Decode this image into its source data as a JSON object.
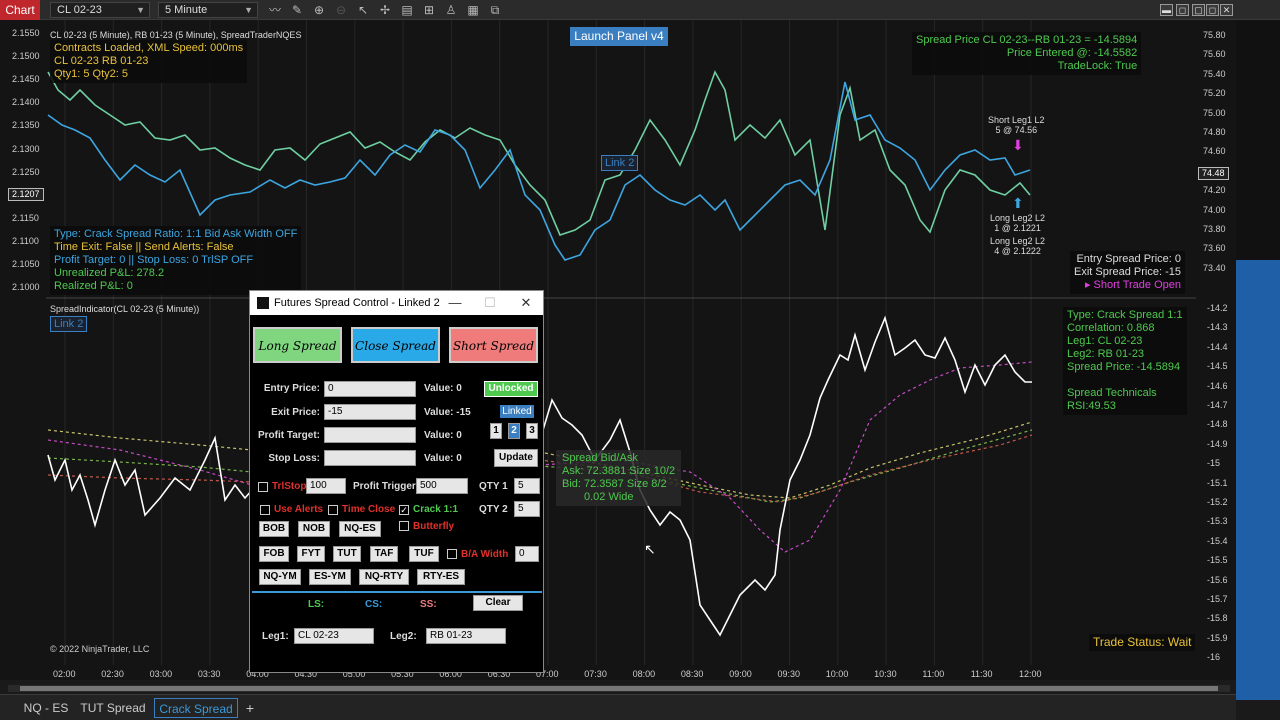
{
  "topbar": {
    "chart_tab": "Chart",
    "instrument": "CL 02-23",
    "interval": "5 Minute"
  },
  "top_panel": {
    "header": "CL 02-23 (5 Minute), RB 01-23 (5 Minute), SpreadTraderNQES",
    "info_lines": [
      "Contracts Loaded,  XML Speed: 000ms",
      "CL 02-23  RB 01-23",
      "Qty1: 5  Qty2: 5"
    ],
    "launch_button": "Launch Panel v4",
    "link_label": "Link 2",
    "spread_price_line": "Spread Price CL 02-23--RB 01-23 = -14.5894",
    "price_entered_line": "Price Entered @: -14.5582",
    "tradelock_line": "TradeLock: True",
    "short_leg_label": [
      "Short Leg1 L2",
      "5 @ 74.56"
    ],
    "long_leg_label_1": [
      "Long Leg2 L2",
      "1 @ 2.1221"
    ],
    "long_leg_label_2": [
      "Long Leg2 L2",
      "4 @ 2.1222"
    ],
    "status_lines": [
      "Type: Crack Spread Ratio: 1:1  Bid Ask Width OFF",
      "Time Exit: False  ||  Send Alerts: False",
      "Profit Target: 0  ||  Stop Loss: 0  TrlSP OFF",
      "Unrealized P&L: 278.2",
      "Realized P&L: 0"
    ],
    "entry_spread": "Entry Spread Price: 0",
    "exit_spread": "Exit Spread Price: -15",
    "short_trade_open": "▸ Short Trade Open",
    "left_axis": [
      "2.1550",
      "2.1500",
      "2.1450",
      "2.1400",
      "2.1350",
      "2.1300",
      "2.1250",
      "2.1200",
      "2.1150",
      "2.1100",
      "2.1050",
      "2.1000"
    ],
    "left_current": "2.1207",
    "right_axis": [
      "75.80",
      "75.60",
      "75.40",
      "75.20",
      "75.00",
      "74.80",
      "74.60",
      "74.40",
      "74.20",
      "74.00",
      "73.80",
      "73.60",
      "73.40"
    ],
    "right_current": "74.48"
  },
  "bottom_panel": {
    "header": "SpreadIndicator(CL 02-23 (5 Minute))",
    "link_label": "Link 2",
    "info_lines": [
      "Type: Crack Spread 1:1",
      "Correlation: 0.868",
      "Leg1: CL 02-23",
      "Leg2: RB 01-23",
      "Spread Price: -14.5894",
      "",
      "Spread Technicals",
      "RSI:49.53"
    ],
    "bid_ask_lines": [
      "Spread Bid/Ask",
      "Ask: 72.3881  Size 10/2",
      "Bid: 72.3587  Size 8/2",
      "0.02 Wide"
    ],
    "trade_status": "Trade Status: Wait",
    "copyright": "© 2022 NinjaTrader, LLC",
    "right_axis": [
      "-14.2",
      "-14.3",
      "-14.4",
      "-14.5",
      "-14.6",
      "-14.7",
      "-14.8",
      "-14.9",
      "-15",
      "-15.1",
      "-15.2",
      "-15.3",
      "-15.4",
      "-15.5",
      "-15.6",
      "-15.7",
      "-15.8",
      "-15.9",
      "-16"
    ]
  },
  "time_axis": [
    "02:00",
    "02:30",
    "03:00",
    "03:30",
    "04:00",
    "04:30",
    "05:00",
    "05:30",
    "06:00",
    "06:30",
    "07:00",
    "07:30",
    "08:00",
    "08:30",
    "09:00",
    "09:30",
    "10:00",
    "10:30",
    "11:00",
    "11:30",
    "12:00"
  ],
  "dialog": {
    "title": "Futures Spread Control - Linked 2",
    "long_spread": "Long Spread",
    "close_spread": "Close Spread",
    "short_spread": "Short Spread",
    "entry_price_label": "Entry Price:",
    "entry_price_value": "0",
    "entry_value_label": "Value: 0",
    "exit_price_label": "Exit Price:",
    "exit_price_value": "-15",
    "exit_value_label": "Value: -15",
    "profit_target_label": "Profit Target:",
    "profit_target_value": "",
    "profit_value_label": "Value: 0",
    "stop_loss_label": "Stop Loss:",
    "stop_loss_value": "",
    "stop_value_label": "Value: 0",
    "unlocked": "Unlocked",
    "linked": "Linked",
    "link_nums": [
      "1",
      "2",
      "3"
    ],
    "update": "Update",
    "trlstop_label": "TrlStop",
    "trlstop_value": "100",
    "profit_trigger_label": "Profit Trigger",
    "profit_trigger_value": "500",
    "qty1_label": "QTY 1",
    "qty1_value": "5",
    "qty2_label": "QTY 2",
    "qty2_value": "5",
    "use_alerts": "Use Alerts",
    "time_close": "Time Close",
    "crack": "Crack 1:1",
    "butterfly": "Butterfly",
    "ba_width": "B/A Width",
    "ba_width_value": "0",
    "row1": [
      "BOB",
      "NOB",
      "NQ-ES"
    ],
    "row2": [
      "FOB",
      "FYT",
      "TUT",
      "TAF",
      "TUF"
    ],
    "row3": [
      "NQ-YM",
      "ES-YM",
      "NQ-RTY",
      "RTY-ES"
    ],
    "ls": "LS:",
    "cs": "CS:",
    "ss": "SS:",
    "clear": "Clear",
    "leg1_label": "Leg1:",
    "leg1_value": "CL 02-23",
    "leg2_label": "Leg2:",
    "leg2_value": "RB 01-23",
    "colors": {
      "long": "#7fd67f",
      "close": "#2aa9e8",
      "short": "#f07b7b"
    }
  },
  "bottom_tabs": [
    "NQ - ES",
    "TUT Spread",
    "Crack Spread",
    "+"
  ]
}
